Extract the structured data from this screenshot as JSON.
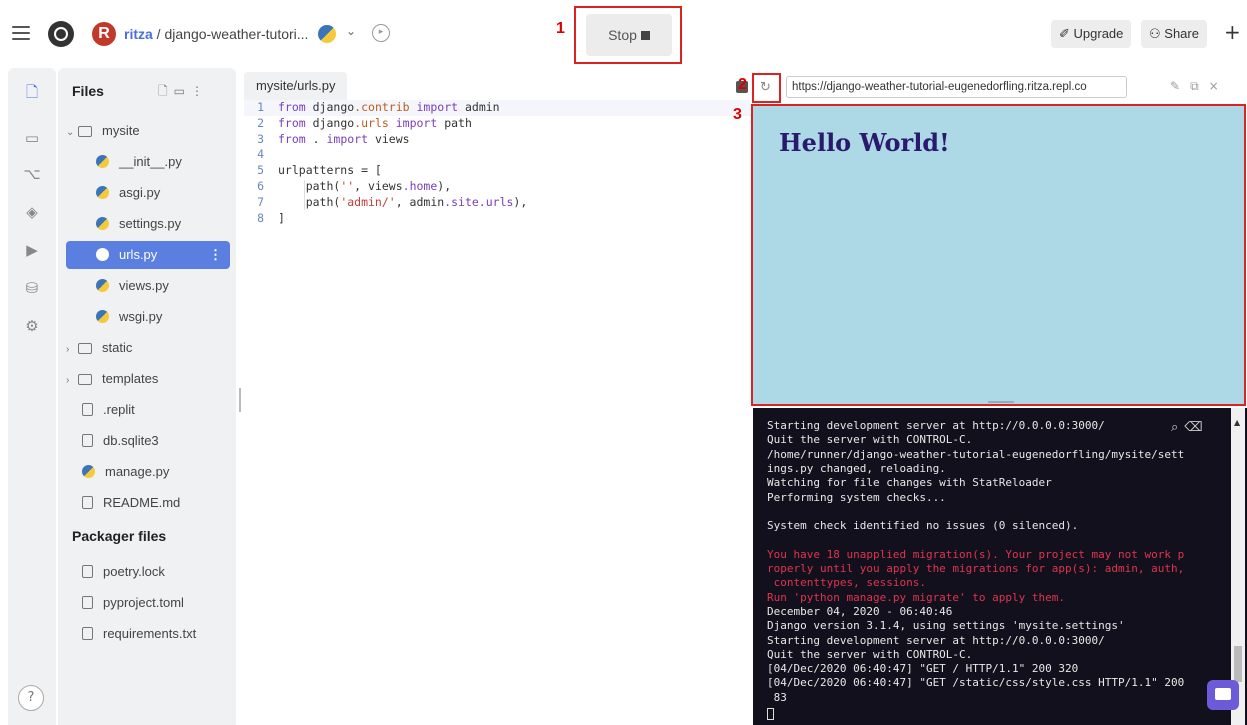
{
  "topbar": {
    "owner": "ritza",
    "separator": " / ",
    "repl_name": "django-weather-tutori...",
    "stop_label": "Stop",
    "upgrade_label": "Upgrade",
    "share_label": "Share",
    "annotation_1": "1",
    "annotation_2": "2",
    "annotation_3": "3"
  },
  "files": {
    "header": "Files",
    "items": [
      {
        "label": "mysite",
        "type": "folder-open"
      },
      {
        "label": "__init__.py",
        "type": "py"
      },
      {
        "label": "asgi.py",
        "type": "py"
      },
      {
        "label": "settings.py",
        "type": "py"
      },
      {
        "label": "urls.py",
        "type": "py",
        "selected": true
      },
      {
        "label": "views.py",
        "type": "py"
      },
      {
        "label": "wsgi.py",
        "type": "py"
      },
      {
        "label": "static",
        "type": "folder"
      },
      {
        "label": "templates",
        "type": "folder"
      },
      {
        "label": ".replit",
        "type": "file"
      },
      {
        "label": "db.sqlite3",
        "type": "file"
      },
      {
        "label": "manage.py",
        "type": "py"
      },
      {
        "label": "README.md",
        "type": "file"
      }
    ],
    "packager_header": "Packager files",
    "packager_items": [
      {
        "label": "poetry.lock"
      },
      {
        "label": "pyproject.toml"
      },
      {
        "label": "requirements.txt"
      }
    ]
  },
  "editor": {
    "tab_label": "mysite/urls.py",
    "lines": [
      "from django.contrib import admin",
      "from django.urls import path",
      "from . import views",
      "",
      "urlpatterns = [",
      "    path('', views.home),",
      "    path('admin/', admin.site.urls),",
      "]"
    ]
  },
  "webview": {
    "url": "https://django-weather-tutorial-eugenedorfling.ritza.repl.co",
    "heading": "Hello World!",
    "background": "#add8e6"
  },
  "console": {
    "lines": [
      {
        "text": "Starting development server at http://0.0.0.0:3000/",
        "color": "normal"
      },
      {
        "text": "Quit the server with CONTROL-C.",
        "color": "normal"
      },
      {
        "text": "/home/runner/django-weather-tutorial-eugenedorfling/mysite/sett",
        "color": "normal"
      },
      {
        "text": "ings.py changed, reloading.",
        "color": "normal"
      },
      {
        "text": "Watching for file changes with StatReloader",
        "color": "normal"
      },
      {
        "text": "Performing system checks...",
        "color": "normal"
      },
      {
        "text": "",
        "color": "normal"
      },
      {
        "text": "System check identified no issues (0 silenced).",
        "color": "normal"
      },
      {
        "text": "",
        "color": "normal"
      },
      {
        "text": "You have 18 unapplied migration(s). Your project may not work p",
        "color": "red"
      },
      {
        "text": "roperly until you apply the migrations for app(s): admin, auth,",
        "color": "red"
      },
      {
        "text": " contenttypes, sessions.",
        "color": "red"
      },
      {
        "text": "Run 'python manage.py migrate' to apply them.",
        "color": "red"
      },
      {
        "text": "December 04, 2020 - 06:40:46",
        "color": "normal"
      },
      {
        "text": "Django version 3.1.4, using settings 'mysite.settings'",
        "color": "normal"
      },
      {
        "text": "Starting development server at http://0.0.0.0:3000/",
        "color": "normal"
      },
      {
        "text": "Quit the server with CONTROL-C.",
        "color": "normal"
      },
      {
        "text": "[04/Dec/2020 06:40:47] \"GET / HTTP/1.1\" 200 320",
        "color": "normal"
      },
      {
        "text": "[04/Dec/2020 06:40:47] \"GET /static/css/style.css HTTP/1.1\" 200",
        "color": "normal"
      },
      {
        "text": " 83",
        "color": "normal"
      }
    ]
  },
  "help_label": "?",
  "colors": {
    "accent": "#5b7fe0",
    "annotation": "#dd2222",
    "console_bg": "#12101c",
    "console_red": "#e0344e"
  }
}
